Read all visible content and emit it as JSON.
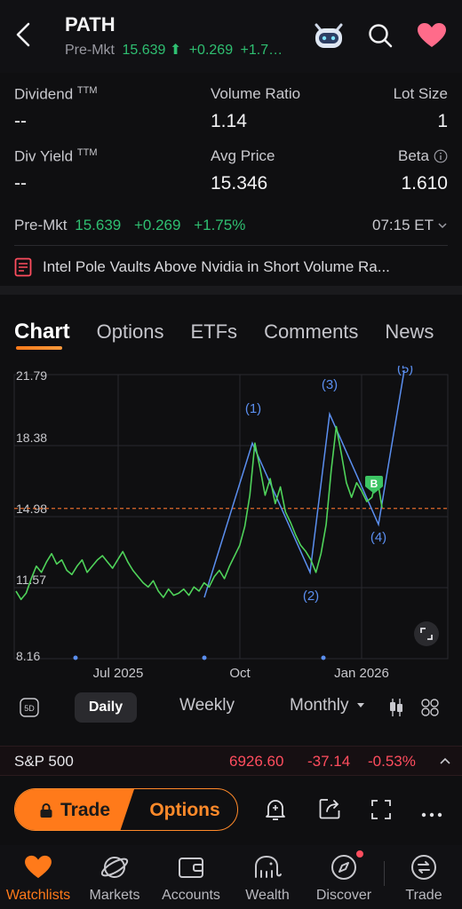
{
  "header": {
    "ticker": "PATH",
    "premkt_label": "Pre-Mkt",
    "premkt_price": "15.639",
    "premkt_arrow": "⬆",
    "premkt_change": "+0.269",
    "premkt_pct_truncated": "+1.7…",
    "icons": [
      "back-chevron",
      "robot-assistant",
      "search",
      "heart-favorite"
    ],
    "colors": {
      "green": "#2fbf71",
      "heart": "#ff6b8a"
    }
  },
  "stats": {
    "dividend": {
      "label": "Dividend",
      "sup": "TTM",
      "value": "--"
    },
    "volume_ratio": {
      "label": "Volume Ratio",
      "value": "1.14"
    },
    "lot_size": {
      "label": "Lot Size",
      "value": "1"
    },
    "div_yield": {
      "label": "Div Yield",
      "sup": "TTM",
      "value": "--"
    },
    "avg_price": {
      "label": "Avg Price",
      "value": "15.346"
    },
    "beta": {
      "label": "Beta",
      "value": "1.610"
    }
  },
  "premkt_row": {
    "label": "Pre-Mkt",
    "price": "15.639",
    "change": "+0.269",
    "pct": "+1.75%",
    "time": "07:15 ET"
  },
  "news": {
    "headline": "Intel Pole Vaults Above Nvidia in Short Volume Ra..."
  },
  "tabs": [
    "Chart",
    "Options",
    "ETFs",
    "Comments",
    "News"
  ],
  "chart_data": {
    "type": "line",
    "y_ticks": [
      "21.79",
      "18.38",
      "14.98",
      "11.57",
      "8.16"
    ],
    "ylim": [
      8.16,
      21.79
    ],
    "x_ticks": [
      "Jul 2025",
      "Oct",
      "Jan 2026"
    ],
    "reference_line": 15.37,
    "series": [
      {
        "values": [
          11.4,
          11.0,
          11.3,
          12.0,
          12.6,
          12.3,
          12.8,
          13.2,
          12.7,
          12.9,
          12.4,
          12.2,
          12.6,
          12.9,
          12.3,
          12.6,
          12.9,
          13.1,
          12.8,
          12.5,
          12.9,
          13.3,
          12.8,
          12.4,
          12.1,
          11.8,
          11.6,
          11.9,
          11.4,
          11.1,
          11.5,
          11.2,
          11.3,
          11.5,
          11.2,
          11.6,
          11.4,
          11.8,
          11.6,
          12.1,
          12.4,
          12.0,
          12.6,
          13.1,
          13.6,
          14.5,
          16.0,
          18.5,
          17.3,
          16.0,
          16.8,
          15.6,
          16.4,
          15.2,
          14.7,
          14.1,
          13.6,
          13.3,
          12.9,
          12.3,
          13.2,
          14.6,
          17.2,
          19.3,
          18.0,
          16.6,
          15.9,
          16.6,
          16.2,
          15.7,
          15.9,
          16.9,
          15.4
        ]
      }
    ],
    "wave_labels": [
      "(1)",
      "(2)",
      "(3)",
      "(4)",
      "(5)"
    ],
    "wave_points": [
      {
        "x": 0,
        "y": 11.1
      },
      {
        "x": 1,
        "y": 18.5
      },
      {
        "x": 2,
        "y": 12.3
      },
      {
        "x": 3,
        "y": 19.9
      },
      {
        "x": 4,
        "y": 14.6
      },
      {
        "x": 5,
        "y": 22.0
      }
    ],
    "marker": "B",
    "colors": {
      "line": "#4fd35a",
      "wave": "#5b8ff0",
      "ref": "#e0692b",
      "marker": "#3cc463"
    }
  },
  "periods": {
    "five_day_icon": "5D",
    "daily": "Daily",
    "weekly": "Weekly",
    "monthly": "Monthly"
  },
  "index_bar": {
    "name": "S&P 500",
    "value": "6926.60",
    "change": "-37.14",
    "pct": "-0.53%"
  },
  "trade_bar": {
    "trade_label": "Trade",
    "options_label": "Options"
  },
  "bottom_nav": [
    {
      "label": "Watchlists",
      "icon": "heart-icon"
    },
    {
      "label": "Markets",
      "icon": "planet-icon"
    },
    {
      "label": "Accounts",
      "icon": "wallet-icon"
    },
    {
      "label": "Wealth",
      "icon": "elephant-icon"
    },
    {
      "label": "Discover",
      "icon": "compass-icon"
    },
    {
      "label": "Trade",
      "icon": "trade-icon"
    }
  ]
}
